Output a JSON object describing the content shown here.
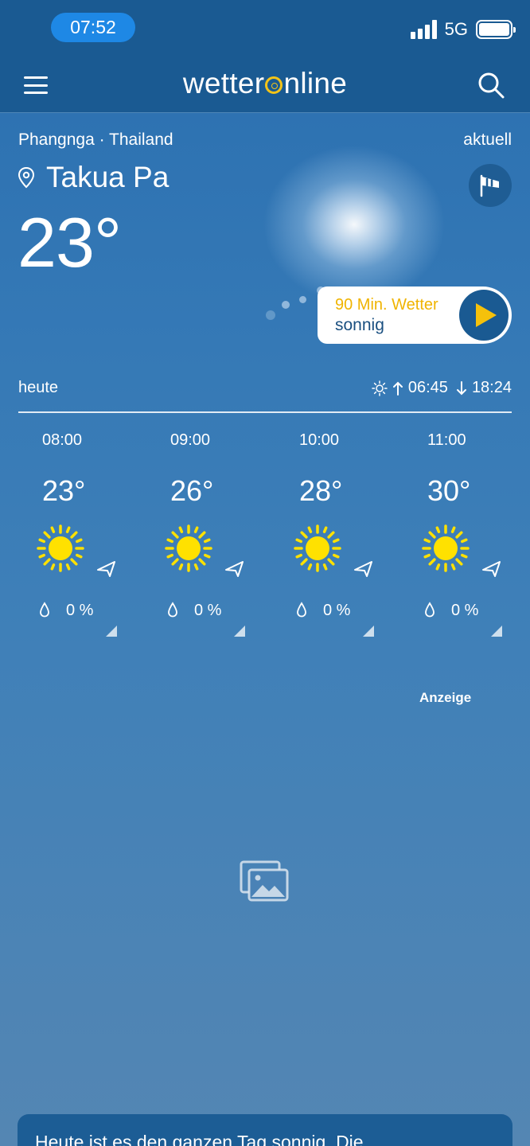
{
  "status_bar": {
    "time": "07:52",
    "network": "5G"
  },
  "app_bar": {
    "logo_prefix": "wetter",
    "logo_suffix": "nline"
  },
  "location": {
    "region": "Phangnga · Thailand",
    "city": "Takua Pa",
    "status": "aktuell"
  },
  "current": {
    "temperature": "23°"
  },
  "nowcast": {
    "title": "90 Min. Wetter",
    "description": "sonnig"
  },
  "today": {
    "label": "heute",
    "sunrise": "06:45",
    "sunset": "18:24"
  },
  "hourly": [
    {
      "time": "08:00",
      "temp": "23°",
      "precip": "0 %",
      "icon": "sun-icon"
    },
    {
      "time": "09:00",
      "temp": "26°",
      "precip": "0 %",
      "icon": "sun-icon"
    },
    {
      "time": "10:00",
      "temp": "28°",
      "precip": "0 %",
      "icon": "sun-icon"
    },
    {
      "time": "11:00",
      "temp": "30°",
      "precip": "0 %",
      "icon": "sun-icon"
    }
  ],
  "ad": {
    "label": "Anzeige"
  },
  "summary": {
    "text": "Heute ist es den ganzen Tag sonnig. Die"
  },
  "colors": {
    "header": "#1a5a92",
    "accent": "#f5c10b",
    "sun": "#ffe100"
  }
}
